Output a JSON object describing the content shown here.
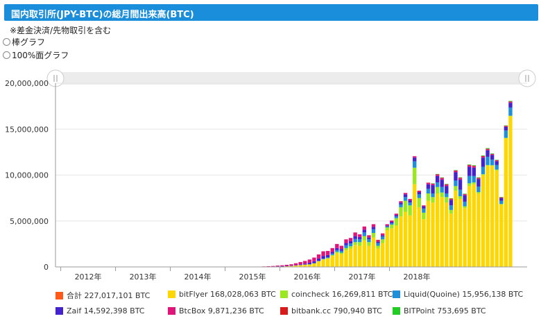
{
  "header": {
    "title": "国内取引所(JPY-BTC)の総月間出来高(BTC)"
  },
  "note": "※差金決済/先物取引を含む",
  "options": [
    {
      "label": "棒グラフ",
      "checked": false
    },
    {
      "label": "100%面グラフ",
      "checked": false
    }
  ],
  "chart_data": {
    "type": "bar",
    "stacked": true,
    "ylim": [
      0,
      20000000
    ],
    "yticks": [
      "20,000,000",
      "15,000,000",
      "10,000,000",
      "5,000,000",
      "0"
    ],
    "xticks": [
      "2012年",
      "2013年",
      "2014年",
      "2015年",
      "2016年",
      "2017年",
      "2018年"
    ],
    "months": 103,
    "start": "2011-12",
    "series": [
      {
        "name": "bitFlyer",
        "color": "#ffd700",
        "values": [
          0,
          0,
          0,
          0,
          0,
          0,
          0,
          0,
          0,
          0,
          0,
          0,
          0,
          0,
          0,
          0,
          0,
          0,
          0,
          0,
          0,
          0,
          0,
          0,
          0,
          0,
          0,
          0,
          0,
          0,
          0,
          0,
          0,
          0,
          0,
          0,
          0,
          0,
          0,
          0,
          0,
          0,
          0,
          0,
          0,
          10000,
          20000,
          30000,
          50000,
          60000,
          80000,
          100000,
          150000,
          200000,
          250000,
          300000,
          400000,
          600000,
          800000,
          900000,
          1200000,
          1500000,
          1400000,
          1800000,
          2000000,
          2400000,
          2300000,
          2900000,
          2300000,
          3200000,
          2000000,
          2600000,
          4000000,
          4200000,
          4500000,
          5500000,
          6000000,
          5600000,
          9000000,
          6500000,
          5200000,
          7200000,
          7000000,
          8000000,
          7600000,
          7000000,
          5800000,
          8300000,
          7400000,
          6400000,
          8800000,
          9000000,
          8000000,
          10000000,
          11000000,
          11000000,
          10500000,
          6800000,
          14000000,
          16400000
        ]
      },
      {
        "name": "coincheck",
        "color": "#9be820",
        "values": [
          0,
          0,
          0,
          0,
          0,
          0,
          0,
          0,
          0,
          0,
          0,
          0,
          0,
          0,
          0,
          0,
          0,
          0,
          0,
          0,
          0,
          0,
          0,
          0,
          0,
          0,
          0,
          0,
          0,
          0,
          0,
          0,
          0,
          0,
          0,
          0,
          0,
          0,
          0,
          0,
          0,
          0,
          0,
          0,
          0,
          0,
          0,
          0,
          0,
          0,
          0,
          0,
          0,
          0,
          0,
          0,
          10000,
          30000,
          50000,
          60000,
          100000,
          150000,
          150000,
          250000,
          250000,
          300000,
          400000,
          450000,
          400000,
          500000,
          300000,
          400000,
          300000,
          400000,
          800000,
          1000000,
          1200000,
          1100000,
          1800000,
          1000000,
          700000,
          800000,
          600000,
          700000,
          500000,
          600000,
          400000,
          500000,
          300000,
          200000,
          300000,
          200000,
          150000,
          100000,
          100000,
          80000,
          100000,
          50000,
          50000,
          60000
        ]
      },
      {
        "name": "Liquid(Quoine)",
        "color": "#1e8fd8",
        "values": [
          0,
          0,
          0,
          0,
          0,
          0,
          0,
          0,
          0,
          0,
          0,
          0,
          0,
          0,
          0,
          0,
          0,
          0,
          0,
          0,
          0,
          0,
          0,
          0,
          0,
          0,
          0,
          0,
          0,
          0,
          0,
          0,
          0,
          0,
          0,
          0,
          0,
          0,
          0,
          0,
          0,
          0,
          0,
          0,
          0,
          0,
          0,
          0,
          0,
          0,
          0,
          0,
          0,
          0,
          0,
          5000,
          10000,
          30000,
          50000,
          80000,
          150000,
          200000,
          200000,
          300000,
          300000,
          350000,
          300000,
          400000,
          300000,
          400000,
          300000,
          300000,
          100000,
          150000,
          200000,
          300000,
          400000,
          300000,
          700000,
          400000,
          450000,
          500000,
          400000,
          500000,
          600000,
          400000,
          500000,
          600000,
          700000,
          500000,
          800000,
          700000,
          600000,
          800000,
          900000,
          600000,
          500000,
          350000,
          800000,
          900000
        ]
      },
      {
        "name": "Zaif",
        "color": "#4422cc",
        "values": [
          0,
          0,
          0,
          0,
          0,
          0,
          0,
          0,
          0,
          0,
          0,
          0,
          0,
          0,
          0,
          0,
          0,
          0,
          0,
          0,
          0,
          0,
          0,
          0,
          0,
          0,
          0,
          0,
          0,
          0,
          0,
          0,
          0,
          0,
          0,
          0,
          0,
          0,
          0,
          0,
          0,
          0,
          0,
          0,
          0,
          5000,
          8000,
          10000,
          15000,
          20000,
          30000,
          40000,
          50000,
          80000,
          100000,
          150000,
          200000,
          250000,
          300000,
          250000,
          200000,
          200000,
          200000,
          250000,
          250000,
          300000,
          250000,
          300000,
          200000,
          250000,
          150000,
          150000,
          100000,
          150000,
          150000,
          200000,
          300000,
          250000,
          400000,
          250000,
          250000,
          500000,
          900000,
          700000,
          800000,
          800000,
          600000,
          900000,
          1100000,
          700000,
          1000000,
          900000,
          800000,
          1000000,
          700000,
          500000,
          400000,
          300000,
          400000,
          500000
        ]
      },
      {
        "name": "BtcBox",
        "color": "#e0157a",
        "values": [
          0,
          0,
          0,
          0,
          0,
          0,
          0,
          0,
          0,
          0,
          0,
          0,
          0,
          0,
          0,
          0,
          0,
          0,
          0,
          0,
          0,
          0,
          0,
          0,
          0,
          0,
          0,
          0,
          0,
          0,
          0,
          0,
          0,
          0,
          0,
          0,
          0,
          0,
          0,
          0,
          10000,
          20000,
          10000,
          20000,
          20000,
          40000,
          50000,
          60000,
          80000,
          100000,
          120000,
          150000,
          200000,
          250000,
          300000,
          350000,
          400000,
          450000,
          500000,
          450000,
          400000,
          450000,
          350000,
          400000,
          350000,
          400000,
          300000,
          350000,
          250000,
          300000,
          200000,
          200000,
          150000,
          150000,
          150000,
          150000,
          150000,
          150000,
          150000,
          150000,
          100000,
          150000,
          150000,
          150000,
          150000,
          150000,
          100000,
          150000,
          150000,
          100000,
          150000,
          150000,
          100000,
          100000,
          100000,
          80000,
          80000,
          50000,
          80000,
          100000
        ]
      },
      {
        "name": "bitbank.cc",
        "color": "#d81a1a",
        "values": [
          0,
          0,
          0,
          0,
          0,
          0,
          0,
          0,
          0,
          0,
          0,
          0,
          0,
          0,
          0,
          0,
          0,
          0,
          0,
          0,
          0,
          0,
          0,
          0,
          0,
          0,
          0,
          0,
          0,
          0,
          0,
          0,
          0,
          0,
          0,
          0,
          0,
          0,
          0,
          0,
          0,
          0,
          0,
          0,
          0,
          0,
          0,
          0,
          0,
          0,
          0,
          0,
          0,
          0,
          0,
          0,
          0,
          0,
          0,
          0,
          0,
          0,
          0,
          0,
          0,
          0,
          0,
          0,
          0,
          0,
          0,
          0,
          0,
          0,
          0,
          0,
          0,
          0,
          0,
          0,
          0,
          20000,
          40000,
          50000,
          60000,
          50000,
          40000,
          50000,
          60000,
          40000,
          50000,
          60000,
          50000,
          70000,
          60000,
          40000,
          40000,
          30000,
          40000,
          50000
        ]
      },
      {
        "name": "BITPoint",
        "color": "#22cc22",
        "values": [
          0,
          0,
          0,
          0,
          0,
          0,
          0,
          0,
          0,
          0,
          0,
          0,
          0,
          0,
          0,
          0,
          0,
          0,
          0,
          0,
          0,
          0,
          0,
          0,
          0,
          0,
          0,
          0,
          0,
          0,
          0,
          0,
          0,
          0,
          0,
          0,
          0,
          0,
          0,
          0,
          0,
          0,
          0,
          0,
          0,
          0,
          0,
          0,
          0,
          0,
          0,
          0,
          0,
          0,
          0,
          0,
          0,
          0,
          0,
          0,
          0,
          0,
          0,
          0,
          0,
          0,
          0,
          0,
          0,
          0,
          0,
          0,
          0,
          0,
          0,
          0,
          0,
          0,
          0,
          0,
          0,
          0,
          10000,
          20000,
          30000,
          40000,
          30000,
          40000,
          50000,
          40000,
          50000,
          60000,
          50000,
          60000,
          70000,
          50000,
          40000,
          30000,
          40000,
          60000
        ]
      }
    ]
  },
  "legend": [
    {
      "label": "合計 227,017,101 BTC",
      "color": "#ff5a1a"
    },
    {
      "label": "bitFlyer 168,028,063 BTC",
      "color": "#ffd700"
    },
    {
      "label": "coincheck 16,269,811 BTC",
      "color": "#9be820"
    },
    {
      "label": "Liquid(Quoine) 15,956,138 BTC",
      "color": "#1e8fd8"
    },
    {
      "label": "Zaif 14,592,398 BTC",
      "color": "#4422cc"
    },
    {
      "label": "BtcBox 9,871,236 BTC",
      "color": "#e0157a"
    },
    {
      "label": "bitbank.cc 790,940 BTC",
      "color": "#d81a1a"
    },
    {
      "label": "BITPoint 753,695 BTC",
      "color": "#22cc22"
    }
  ]
}
